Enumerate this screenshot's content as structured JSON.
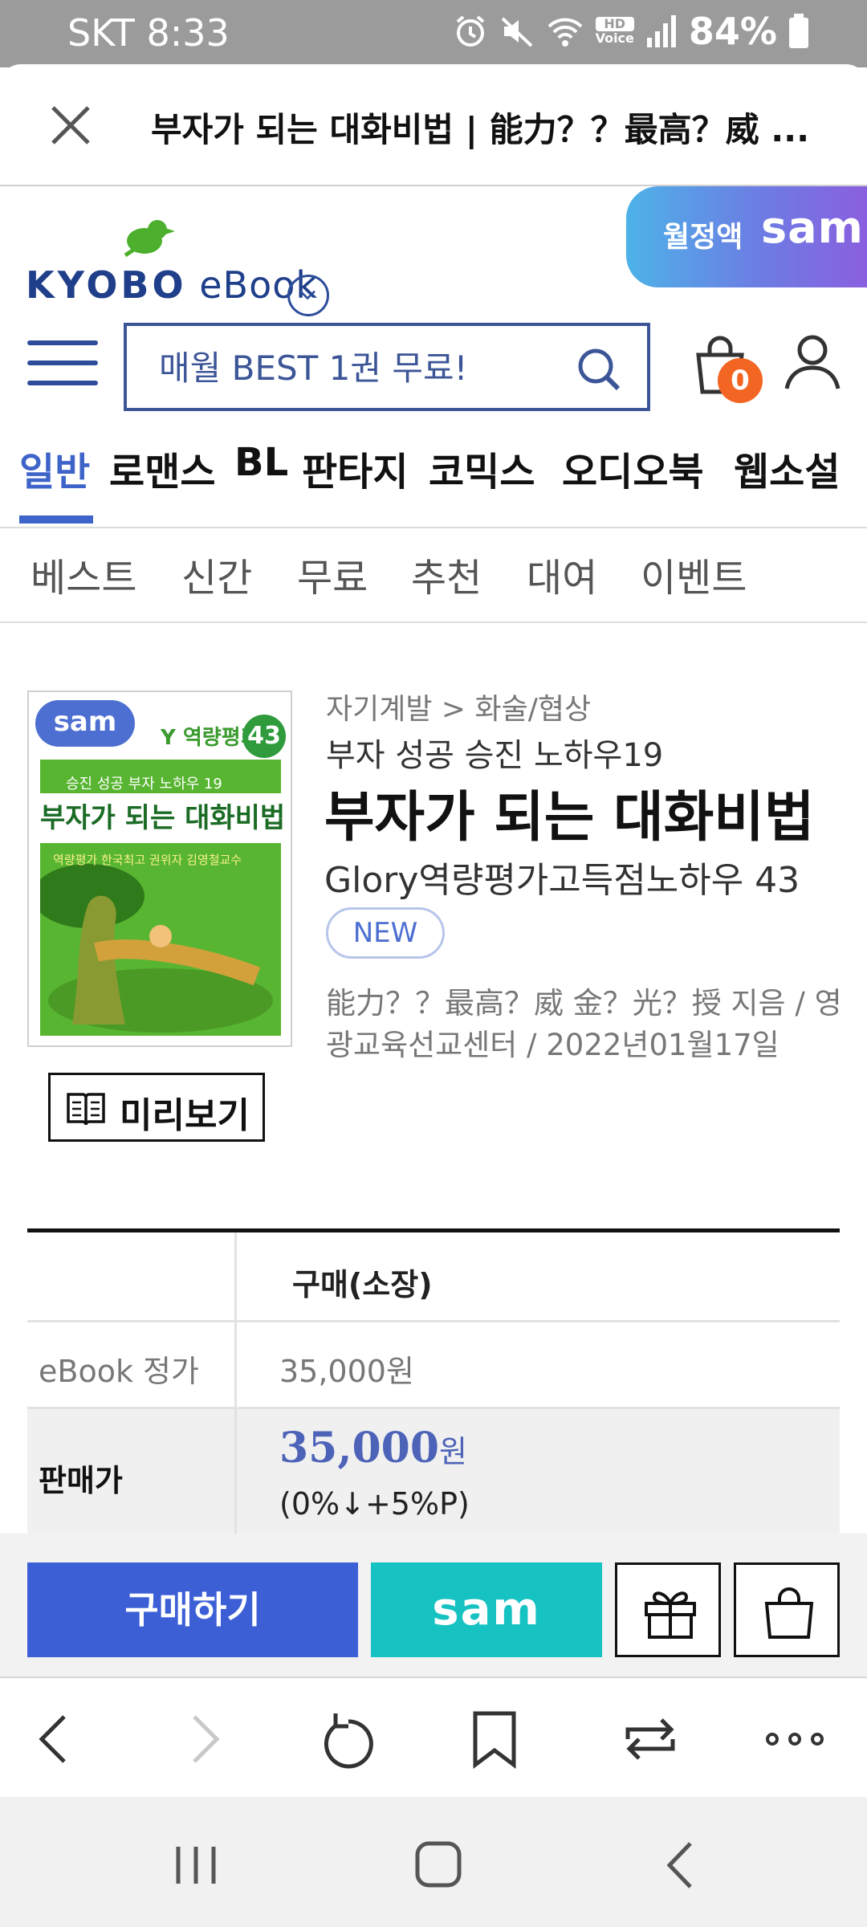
{
  "status_bar": {
    "carrier_time": "SKT 8:33",
    "battery": "84%",
    "hd_label": "HD",
    "voice_label": "Voice"
  },
  "tab_header": {
    "title": "부자가 되는 대화비법 | 能力？？最高？威 ..."
  },
  "site": {
    "logo_kyobo": "KYOBO",
    "logo_ebook": "eBook",
    "sam_tab": {
      "text1": "월정액",
      "text2": "sam"
    },
    "search_placeholder": "매월 BEST 1권 무료!",
    "cart_count": "0"
  },
  "categories": [
    {
      "label": "일반",
      "active": true
    },
    {
      "label": "로맨스"
    },
    {
      "label": "BL"
    },
    {
      "label": "판타지"
    },
    {
      "label": "코믹스"
    },
    {
      "label": "오디오북"
    },
    {
      "label": "웹소설"
    }
  ],
  "subcategories": [
    "베스트",
    "신간",
    "무료",
    "추천",
    "대여",
    "이벤트"
  ],
  "book": {
    "cover": {
      "sam_chip": "sam",
      "brand": "Y 역량평가",
      "number": "43",
      "line1": "승진 성공 부자 노하우 19",
      "main": "부자가 되는 대화비법",
      "line2": "역량평가 한국최고 권위자 김영철교수"
    },
    "preview_label": "미리보기",
    "breadcrumb": "자기계발 > 화술/협상",
    "series": "부자 성공 승진 노하우19",
    "title": "부자가 되는 대화비법",
    "subtitle": "Glory역량평가고득점노하우 43",
    "new_tag": "NEW",
    "author_line": "能力？？最高？威 金？光？授 지음 / 영광교육선교센터 / 2022년01월17일"
  },
  "price_table": {
    "header": "구매(소장)",
    "list_label": "eBook 정가",
    "list_value": "35,000원",
    "sale_label": "판매가",
    "sale_value": "35,000",
    "sale_unit": "원",
    "discount": "(0%↓+5%P)"
  },
  "buy_bar": {
    "buy_label": "구매하기",
    "sam_label": "sam"
  },
  "colors": {
    "brand_blue": "#3c5fd6",
    "accent_teal": "#16c2c2",
    "badge_orange": "#f26522",
    "active_tab": "#3e63c9"
  }
}
